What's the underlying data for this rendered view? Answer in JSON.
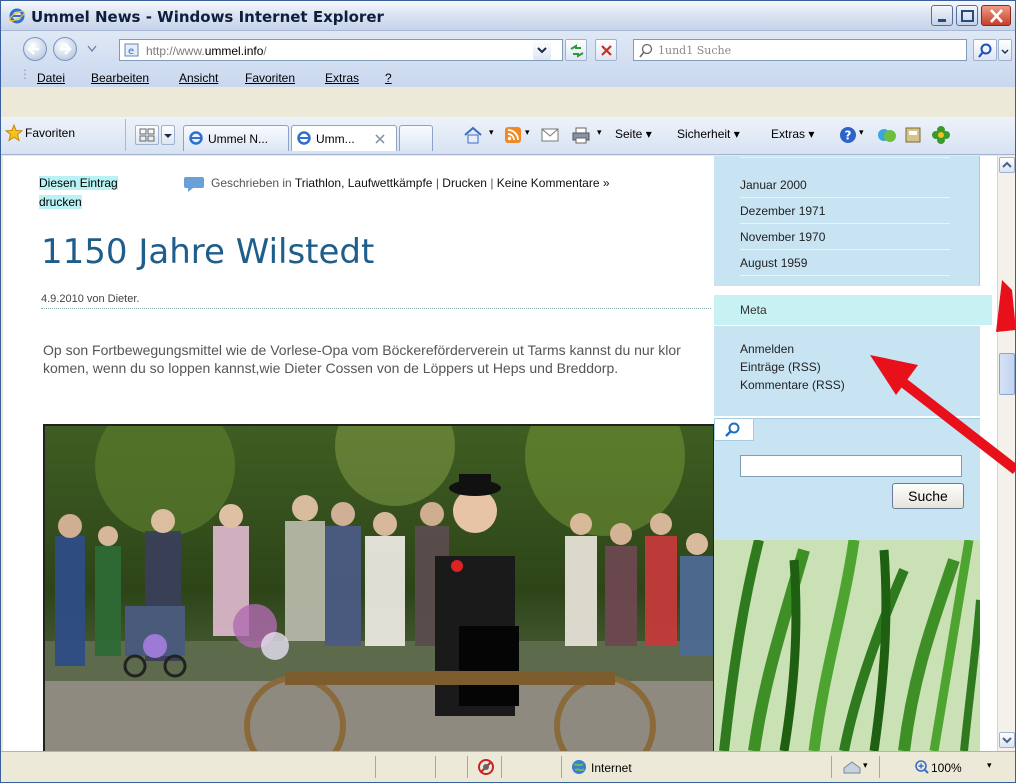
{
  "window": {
    "title": "Ummel News - Windows Internet Explorer",
    "minimize_icon": "minimize-icon",
    "maximize_icon": "maximize-icon",
    "close_icon": "close-icon"
  },
  "address": {
    "url_prefix": "http://www.",
    "url_domain": "ummel.info",
    "url_suffix": "/",
    "search_placeholder": "1und1 Suche"
  },
  "menu": [
    "Datei",
    "Bearbeiten",
    "Ansicht",
    "Favoriten",
    "Extras",
    "?"
  ],
  "favbar": {
    "favorites_label": "Favoriten",
    "tabs": [
      {
        "label": "Ummel N..."
      },
      {
        "label": "Umm..."
      }
    ],
    "tools": {
      "page": "Seite",
      "security": "Sicherheit",
      "extras": "Extras"
    }
  },
  "article": {
    "print_link": "Diesen Eintrag drucken",
    "meta_prefix": "Geschrieben in",
    "categories": "Triathlon, Laufwettkämpfe",
    "sep1": "|",
    "print": "Drucken",
    "sep2": "|",
    "comments": "Keine Kommentare »",
    "title": "1150 Jahre Wilstedt",
    "byline": "4.9.2010 von Dieter.",
    "body": "Op son Fortbewegungsmittel wie de Vorlese-Opa vom Böckereförderverein ut Tarms kannst du nur klor komen, wenn du so loppen kannst,wie Dieter Cossen von de Löppers ut Heps und  Breddorp."
  },
  "sidebar": {
    "archive": [
      "Januar 2000",
      "Dezember 1971",
      "November 1970",
      "August 1959"
    ],
    "meta_title": "Meta",
    "meta_links": [
      "Anmelden",
      "Einträge (RSS)",
      "Kommentare (RSS)"
    ],
    "search_button": "Suche",
    "search_value": ""
  },
  "status": {
    "zone": "Internet",
    "zoom": "100%"
  },
  "colors": {
    "accent_title": "#1f5e8b",
    "sidebar_bg": "#c8e3f2",
    "meta_head_bg": "#c7f1f3",
    "highlight": "#b8f2f4",
    "annotation_arrow": "#e8101a"
  }
}
